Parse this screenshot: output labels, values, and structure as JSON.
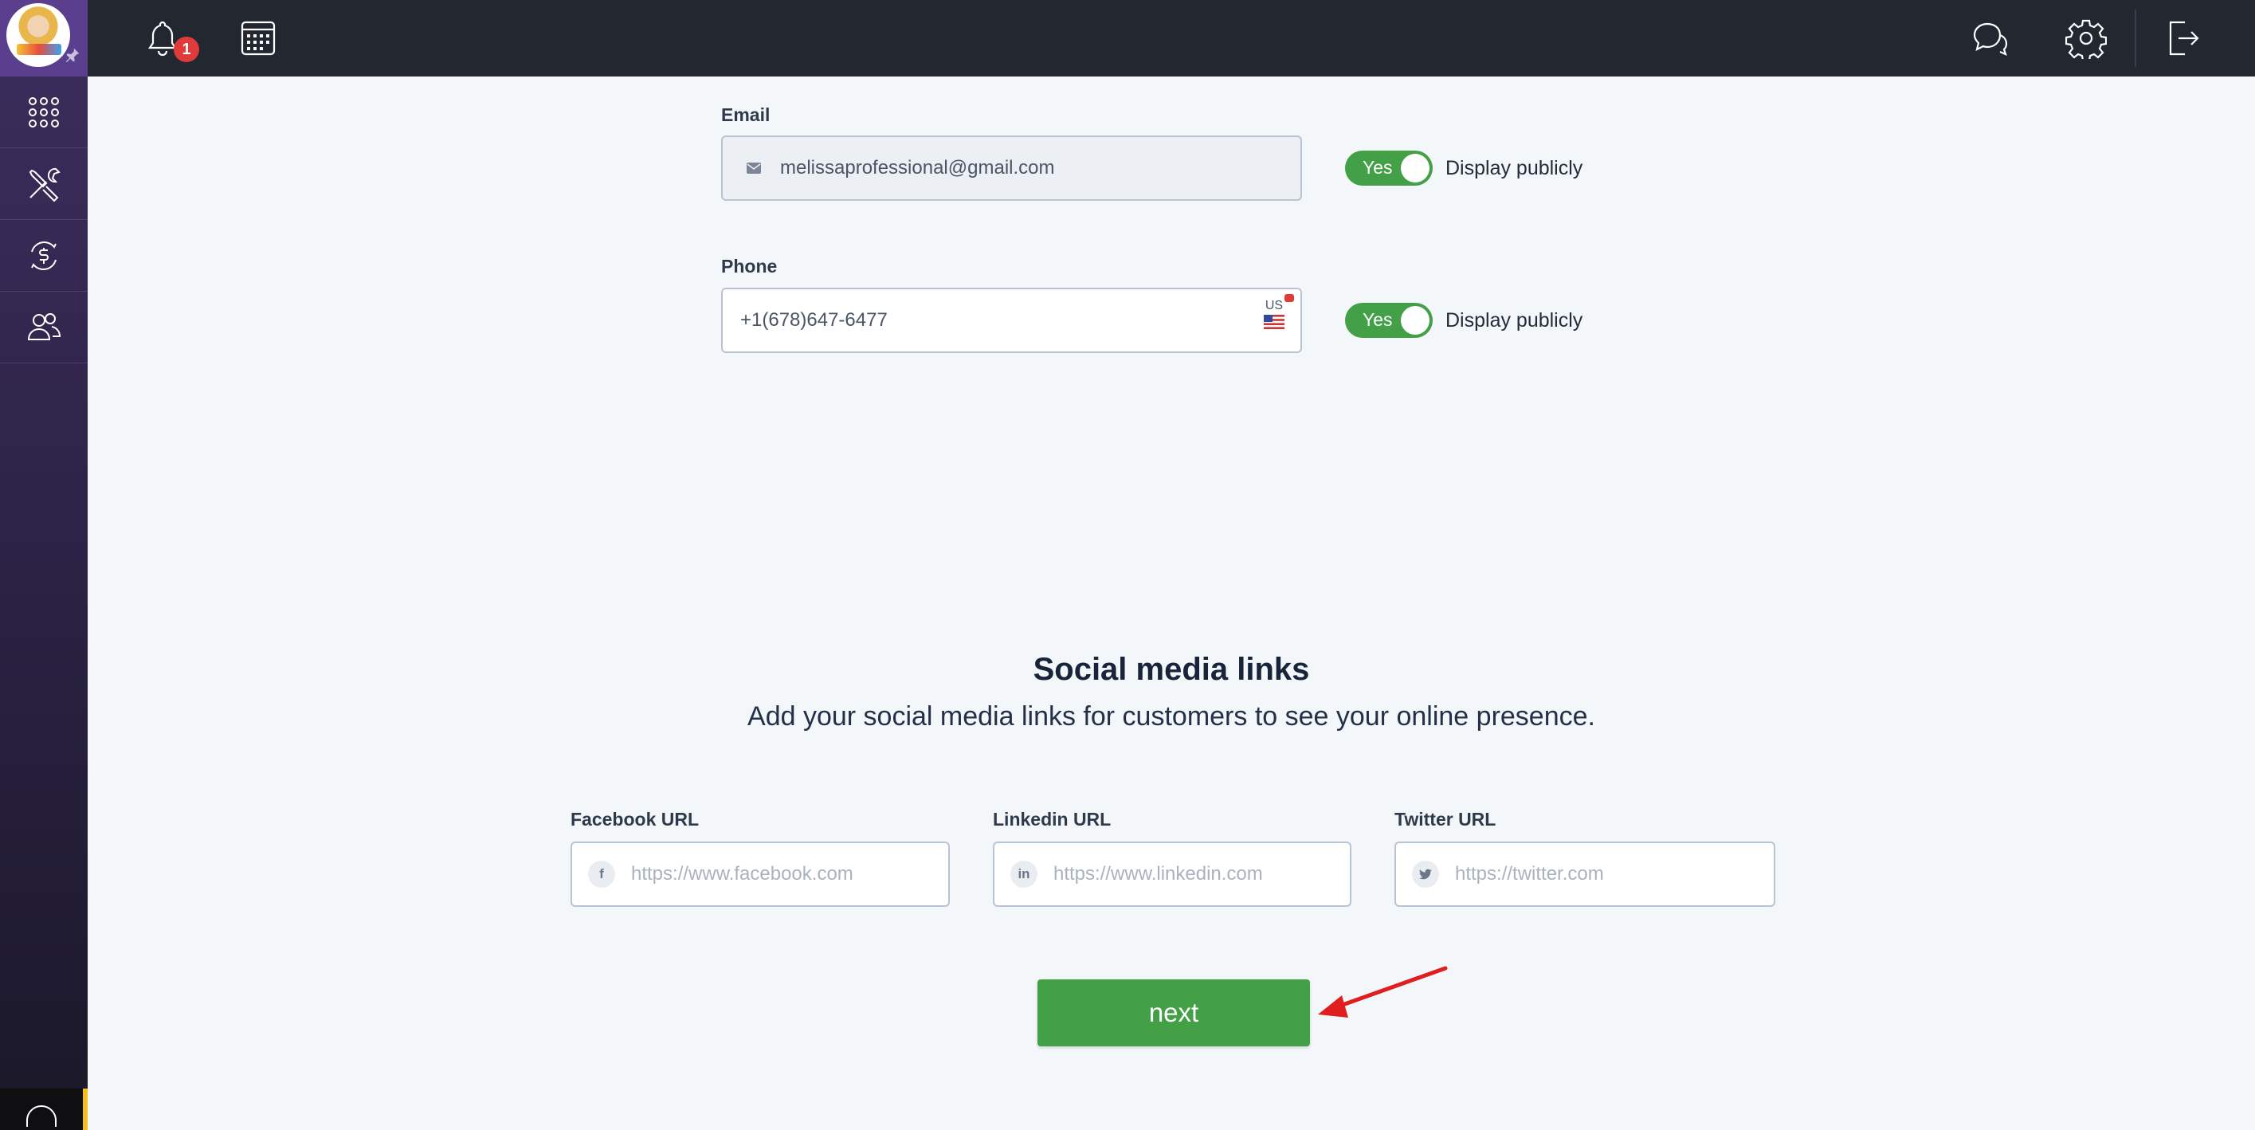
{
  "notifications": {
    "count": "1"
  },
  "email": {
    "label": "Email",
    "value": "melissaprofessional@gmail.com",
    "toggle": "Yes",
    "display_text": "Display publicly"
  },
  "phone": {
    "label": "Phone",
    "value": "+1(678)647-6477",
    "country": "US",
    "toggle": "Yes",
    "display_text": "Display publicly"
  },
  "social": {
    "title": "Social media links",
    "subtitle": "Add your social media links for customers to see your online presence.",
    "facebook": {
      "label": "Facebook URL",
      "placeholder": "https://www.facebook.com",
      "icon": "f"
    },
    "linkedin": {
      "label": "Linkedin URL",
      "placeholder": "https://www.linkedin.com",
      "icon": "in"
    },
    "twitter": {
      "label": "Twitter URL",
      "placeholder": "https://twitter.com"
    }
  },
  "actions": {
    "next": "next"
  },
  "colors": {
    "accent_green": "#43a047",
    "topbar": "#222730",
    "sidebar": "#2a2142",
    "badge": "#e03a3a"
  }
}
